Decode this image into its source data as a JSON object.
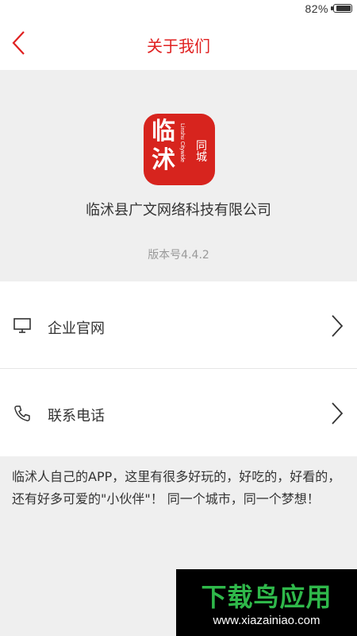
{
  "status_bar": {
    "battery": "82%",
    "battery_level": 0.82
  },
  "nav": {
    "title": "关于我们",
    "back_icon": "chevron-left-icon"
  },
  "brand_color": "#e02020",
  "about": {
    "logo": {
      "main_1": "临",
      "main_2": "沭",
      "side": "同城",
      "vertical": "Linshu Citywide"
    },
    "company_name": "临沭县广文网络科技有限公司",
    "version": "版本号4.4.2"
  },
  "menu": [
    {
      "label": "企业官网",
      "icon": "monitor-icon"
    },
    {
      "label": "联系电话",
      "icon": "phone-icon"
    }
  ],
  "intro": "临沭人自己的APP，这里有很多好玩的，好吃的，好看的，还有好多可爱的\"小伙伴\"！ 同一个城市，同一个梦想！",
  "watermark": {
    "title": "下载鸟应用",
    "url": "www.xiazainiao.com"
  }
}
